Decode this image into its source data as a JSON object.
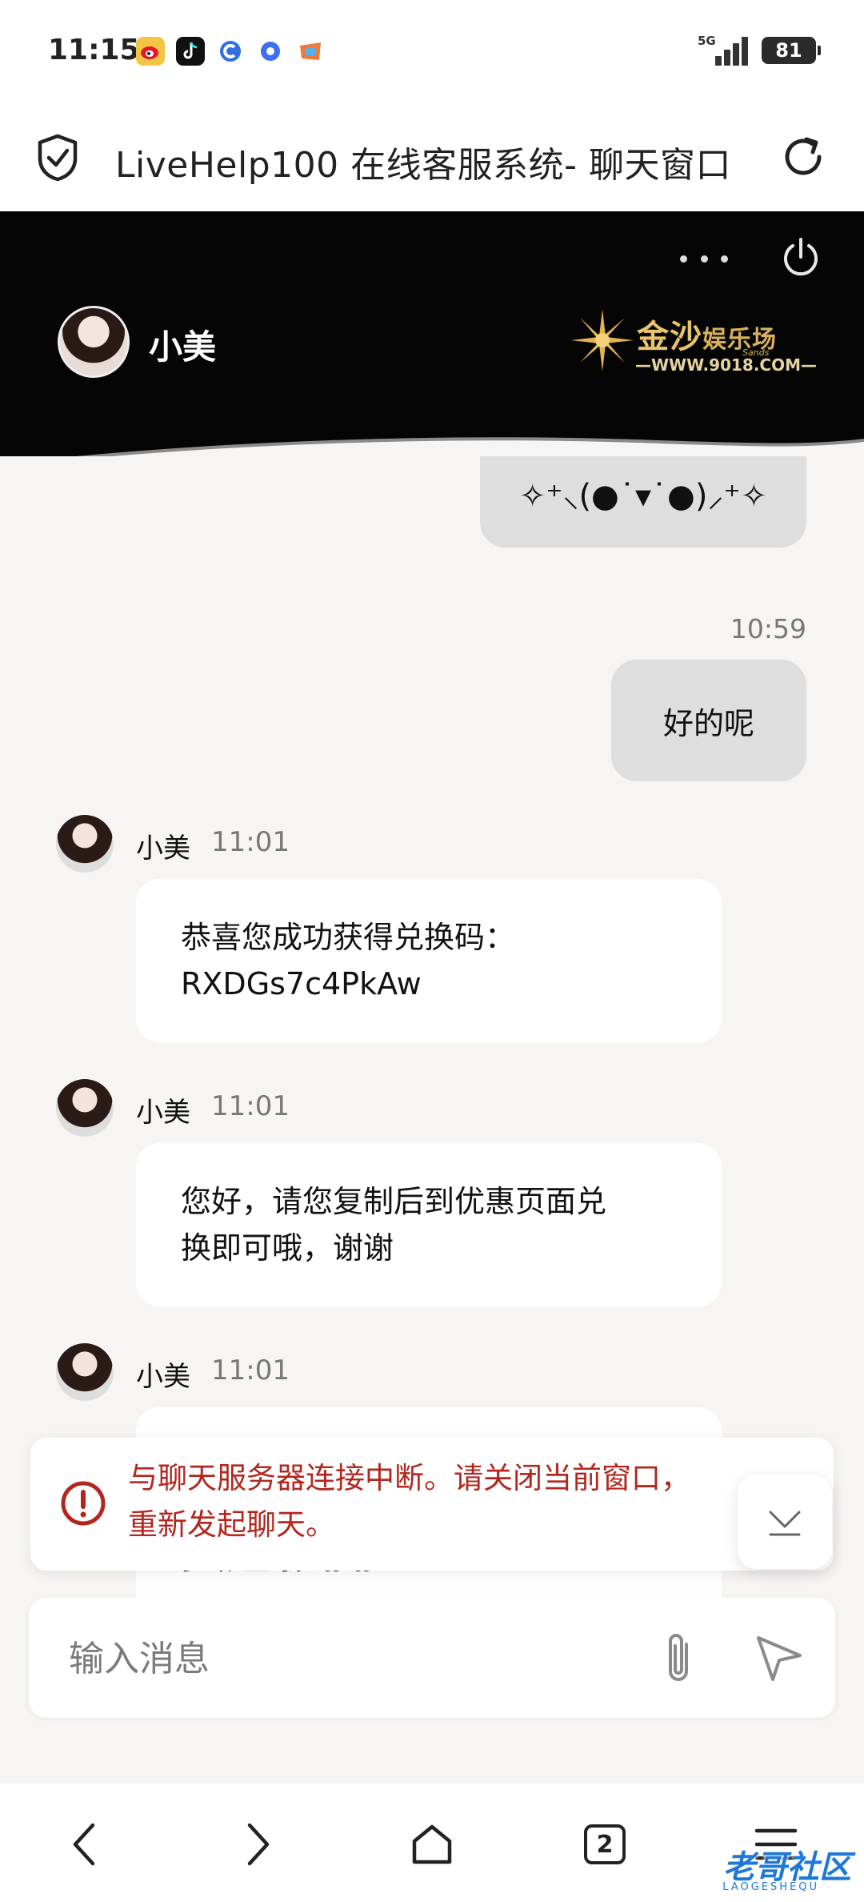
{
  "status_bar": {
    "time": "11:15",
    "network": "5G",
    "battery": "81",
    "app_icons": [
      "weibo-icon",
      "tiktok-icon",
      "browser-c-icon",
      "blue-app-icon",
      "game-icon"
    ]
  },
  "browser": {
    "page_title": "LiveHelp100 在线客服系统- 聊天窗口",
    "tab_count": "2"
  },
  "chat_header": {
    "agent_name": "小美",
    "brand_name": "金沙",
    "brand_suffix": "娱乐场",
    "brand_sub": "Sands",
    "brand_url": "—WWW.9018.COM—"
  },
  "messages": {
    "self_1": {
      "text": "✧⁺⸜(●˙▾˙●)⸝⁺✧"
    },
    "self_2": {
      "time": "10:59",
      "text": "好的呢"
    },
    "agent": [
      {
        "name": "小美",
        "time": "11:01",
        "lines": [
          "恭喜您成功获得兑换码：",
          "RXDGs7c4PkAw"
        ]
      },
      {
        "name": "小美",
        "time": "11:01",
        "lines": [
          "您好，请您复制后到优惠页面兑",
          "换即可哦，谢谢"
        ]
      },
      {
        "name": "小美",
        "time": "11:01",
        "lines": [
          "",
          "",
          "多彩金哦 谢谢!"
        ]
      }
    ]
  },
  "alert": {
    "lines": [
      "与聊天服务器连接中断。请关闭当前窗口，",
      "重新发起聊天。"
    ]
  },
  "composer": {
    "placeholder": "输入消息"
  },
  "watermark": {
    "text": "老哥社区",
    "sub": "LAOGESHEQU"
  },
  "colors": {
    "header_bg": "#050505",
    "alert_text": "#b3261e",
    "self_bubble": "#dedede",
    "page_bg": "#f6f5f4"
  }
}
